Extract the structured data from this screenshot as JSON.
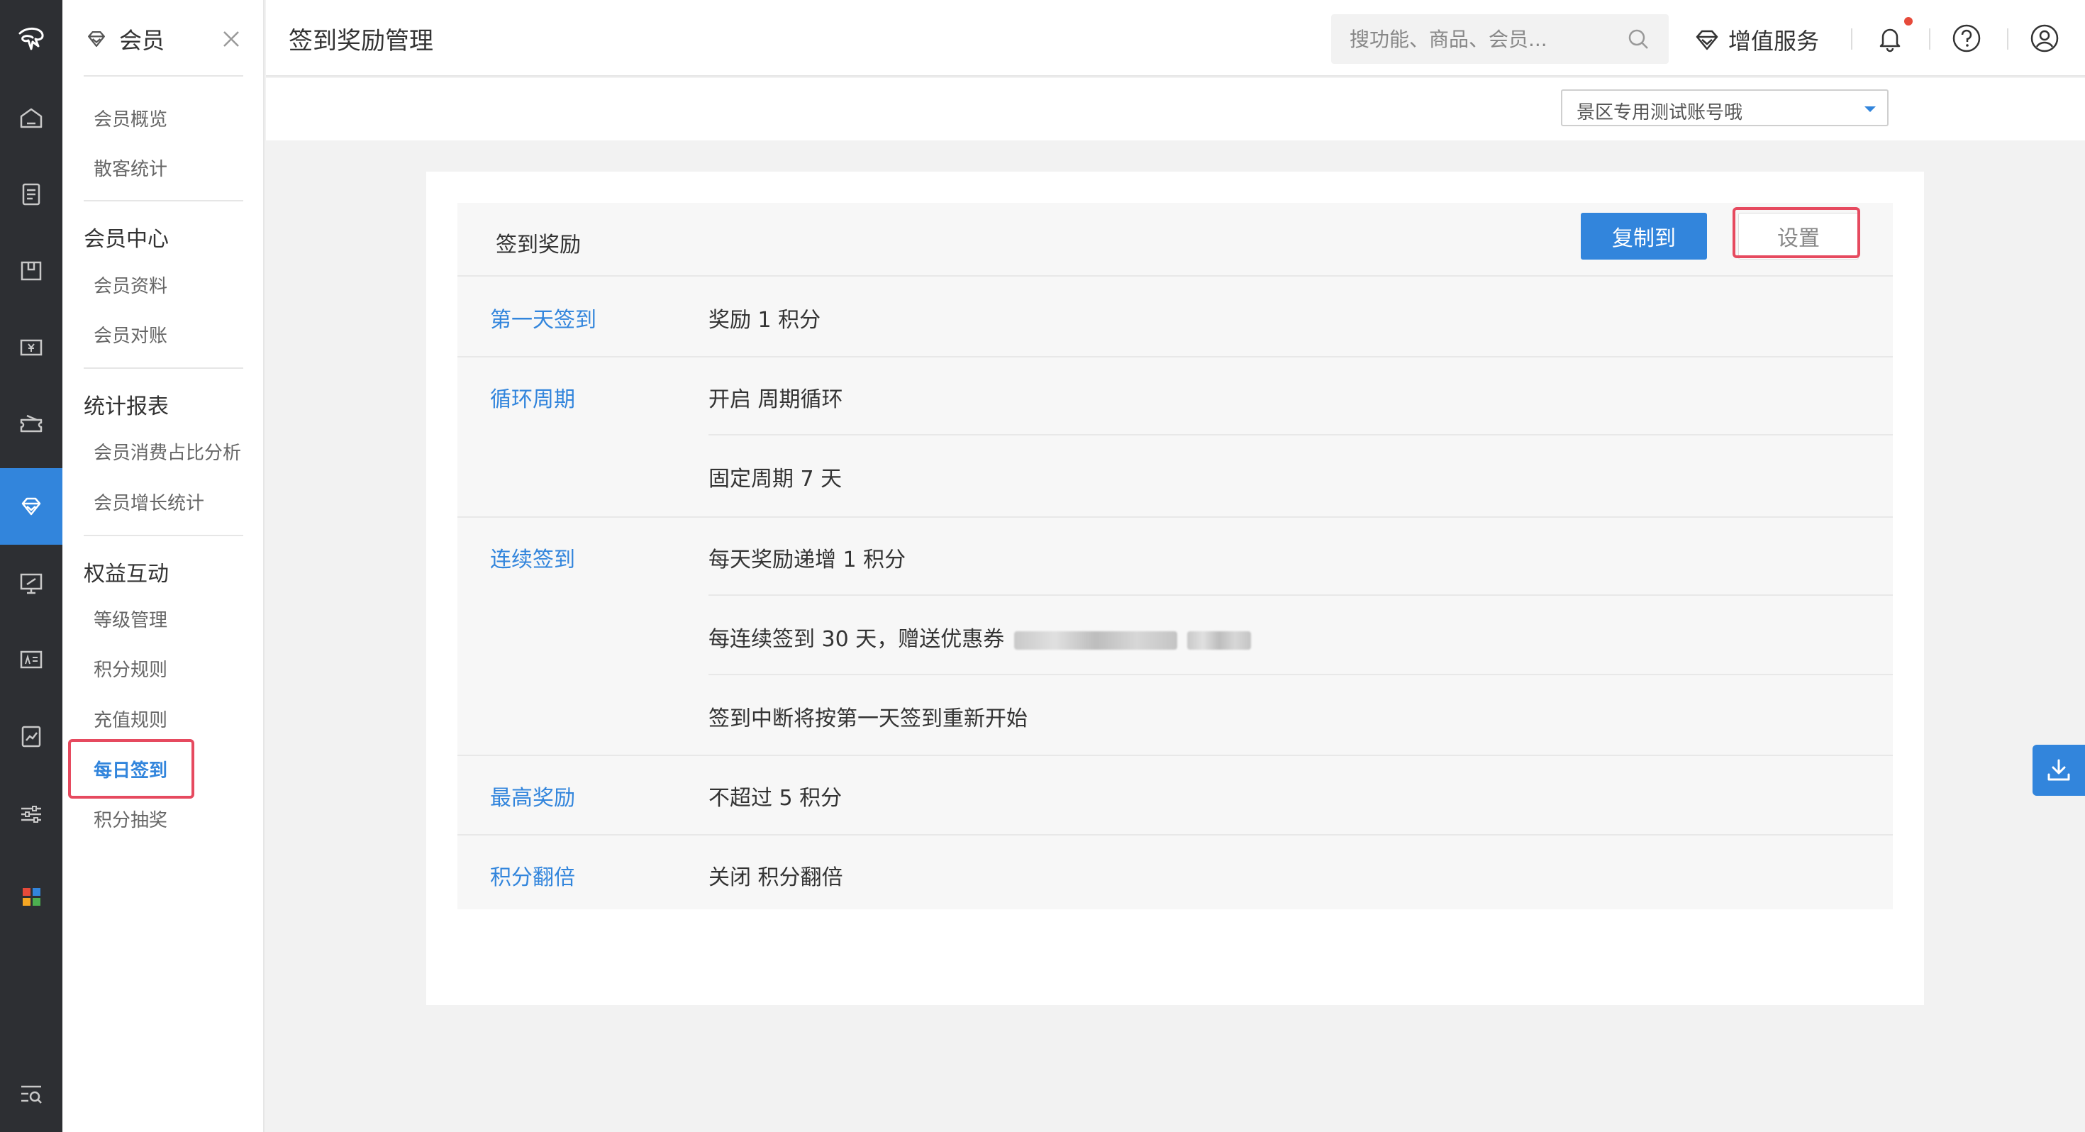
{
  "sidebar": {
    "module_title": "会员",
    "items": [
      {
        "label": "会员概览"
      },
      {
        "label": "散客统计"
      },
      {
        "label": "会员资料"
      },
      {
        "label": "会员对账"
      },
      {
        "label": "会员消费占比分析"
      },
      {
        "label": "会员增长统计"
      },
      {
        "label": "等级管理"
      },
      {
        "label": "积分规则"
      },
      {
        "label": "充值规则"
      },
      {
        "label": "每日签到"
      },
      {
        "label": "积分抽奖"
      }
    ],
    "groups": [
      "会员中心",
      "统计报表",
      "权益互动"
    ],
    "active_item": "每日签到"
  },
  "header": {
    "page_title": "签到奖励管理",
    "search_placeholder": "搜功能、商品、会员...",
    "value_added": "增值服务"
  },
  "account": {
    "selected": "景区专用测试账号哦"
  },
  "panel": {
    "title": "签到奖励",
    "copy_button": "复制到",
    "settings_button": "设置",
    "rows": [
      {
        "label": "第一天签到",
        "lines": [
          "奖励 1 积分"
        ]
      },
      {
        "label": "循环周期",
        "lines": [
          "开启 周期循环",
          "固定周期 7 天"
        ]
      },
      {
        "label": "连续签到",
        "lines": [
          "每天奖励递增 1 积分",
          "每连续签到 30 天，赠送优惠券",
          "签到中断将按第一天签到重新开始"
        ]
      },
      {
        "label": "最高奖励",
        "lines": [
          "不超过 5 积分"
        ]
      },
      {
        "label": "积分翻倍",
        "lines": [
          "关闭 积分翻倍"
        ]
      }
    ]
  },
  "colors": {
    "accent": "#3285dc",
    "highlight": "#e64a5f",
    "rail": "#2d2f33"
  }
}
